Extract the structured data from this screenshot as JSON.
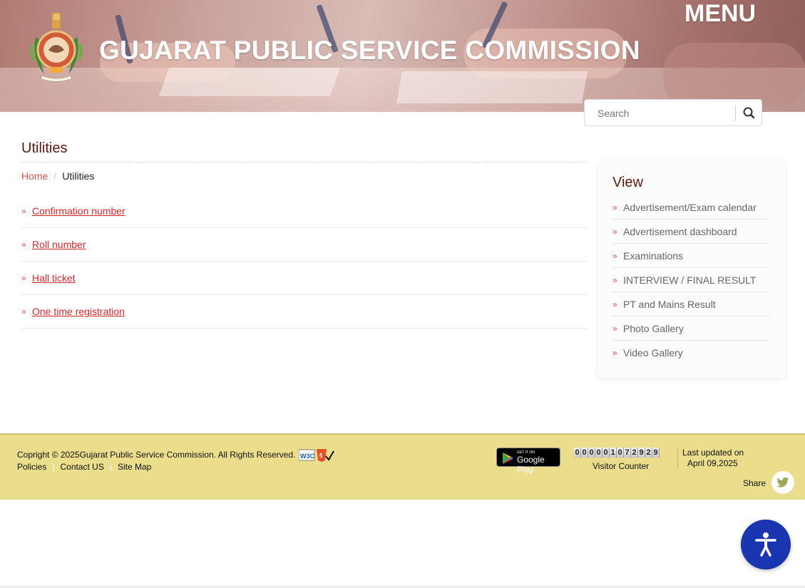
{
  "header": {
    "title": "GUJARAT PUBLIC SERVICE COMMISSION",
    "menu_label": "MENU"
  },
  "search": {
    "placeholder": "Search"
  },
  "page": {
    "title": "Utilities",
    "breadcrumb": {
      "home": "Home",
      "current": "Utilities"
    },
    "utilities": [
      "Confirmation number",
      "Roll number",
      "Hall ticket",
      "One time registration"
    ]
  },
  "sidebar": {
    "title": "View",
    "items": [
      "Advertisement/Exam calendar",
      "Advertisement dashboard",
      "Examinations",
      "INTERVIEW / FINAL RESULT",
      "PT and Mains Result",
      "Photo Gallery",
      "Video Gallery"
    ]
  },
  "footer": {
    "copyright": "Copright © 2025Gujarat Public Service Commission. All Rights Reserved.",
    "links": [
      "Policies",
      "Contact US",
      "Site Map"
    ],
    "google_play_small": "GET IT ON",
    "google_play_big": "Google Play",
    "visitor_count": "0000010729 29",
    "visitor_digits": [
      "0",
      "0",
      "0",
      "0",
      "0",
      "1",
      "0",
      "7",
      "2",
      "9",
      "2",
      "9"
    ],
    "visitor_label": "Visitor Counter",
    "last_updated_label": "Last updated on",
    "last_updated_date": "April 09,2025",
    "share_label": "Share"
  },
  "colors": {
    "accent_red": "#d7262a",
    "heading_brown": "#5b1a0f",
    "footer_bg": "#eadd8c",
    "accessibility_blue": "#1a35b0"
  }
}
